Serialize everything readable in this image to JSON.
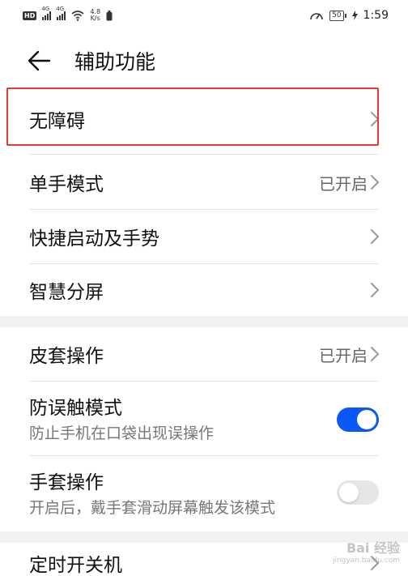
{
  "status_bar": {
    "hd_badge": "HD",
    "signal1_label": "4G",
    "signal2_label": "4G",
    "net_speed_value": "4.8",
    "net_speed_unit": "K/s",
    "battery": "50",
    "time": "1:59"
  },
  "header": {
    "title": "辅助功能"
  },
  "group1": {
    "items": [
      {
        "label": "无障碍"
      },
      {
        "label": "单手模式",
        "status": "已开启"
      },
      {
        "label": "快捷启动及手势"
      },
      {
        "label": "智慧分屏"
      }
    ]
  },
  "group2": {
    "items": [
      {
        "label": "皮套操作",
        "status": "已开启"
      },
      {
        "label": "防误触模式",
        "subtitle": "防止手机在口袋出现误操作",
        "toggle_on": true
      },
      {
        "label": "手套操作",
        "subtitle": "开启后，戴手套滑动屏幕触发该模式",
        "toggle_on": false
      }
    ]
  },
  "group3": {
    "items": [
      {
        "label": "定时开关机"
      }
    ]
  },
  "watermark": {
    "text": "Bai 经验",
    "sub": "jingyan.baidu.com"
  },
  "colors": {
    "accent": "#0a59f7",
    "highlight": "#e53935"
  }
}
